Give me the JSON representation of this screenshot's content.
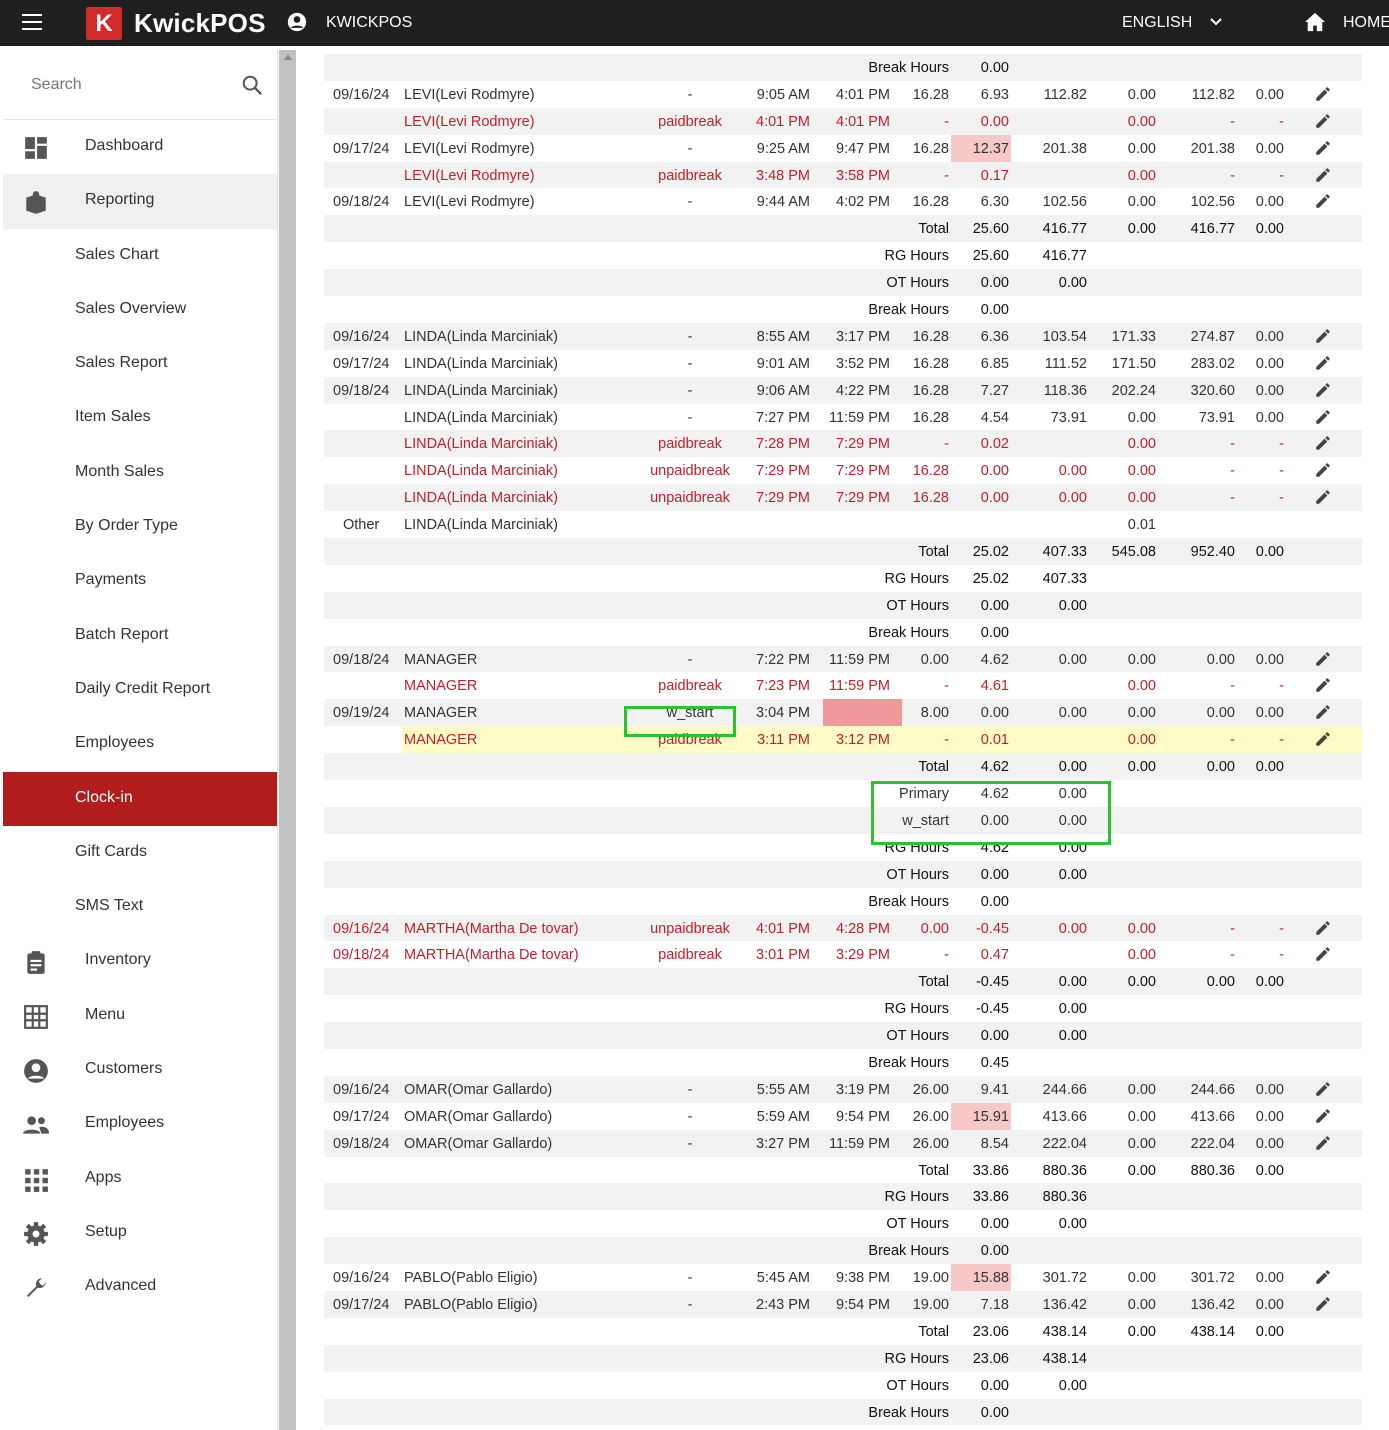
{
  "topbar": {
    "logo_letter": "K",
    "brand": "KwickPOS",
    "store_name": "KWICKPOS",
    "language": "ENGLISH",
    "home_label": "HOME"
  },
  "sidebar": {
    "search_placeholder": "Search",
    "items": [
      {
        "label": "Dashboard",
        "icon": "dashboard-icon",
        "level": "top"
      },
      {
        "label": "Reporting",
        "icon": "reporting-icon",
        "level": "top",
        "open": true
      },
      {
        "label": "Sales Chart",
        "level": "sub"
      },
      {
        "label": "Sales Overview",
        "level": "sub"
      },
      {
        "label": "Sales Report",
        "level": "sub"
      },
      {
        "label": "Item Sales",
        "level": "sub"
      },
      {
        "label": "Month Sales",
        "level": "sub"
      },
      {
        "label": "By Order Type",
        "level": "sub"
      },
      {
        "label": "Payments",
        "level": "sub"
      },
      {
        "label": "Batch Report",
        "level": "sub"
      },
      {
        "label": "Daily Credit Report",
        "level": "sub"
      },
      {
        "label": "Employees",
        "level": "sub"
      },
      {
        "label": "Clock-in",
        "level": "sub",
        "active": true
      },
      {
        "label": "Gift Cards",
        "level": "sub"
      },
      {
        "label": "SMS Text",
        "level": "sub"
      },
      {
        "label": "Inventory",
        "icon": "clipboard-icon",
        "level": "top"
      },
      {
        "label": "Menu",
        "icon": "grid-icon",
        "level": "top"
      },
      {
        "label": "Customers",
        "icon": "account-circle-icon",
        "level": "top"
      },
      {
        "label": "Employees",
        "icon": "people-icon",
        "level": "top"
      },
      {
        "label": "Apps",
        "icon": "apps-icon",
        "level": "top"
      },
      {
        "label": "Setup",
        "icon": "gear-icon",
        "level": "top"
      },
      {
        "label": "Advanced",
        "icon": "wrench-icon",
        "level": "top"
      }
    ]
  },
  "colors": {
    "accent": "#b11d1d",
    "red_text": "#c0202a",
    "highlight_pink": "#f8c8c8",
    "highlight_yellow": "#fffbc7",
    "green_box": "#2dc12d"
  },
  "rows": [
    {
      "kind": "sum",
      "label": "Break Hours",
      "hours": "0.00",
      "shade": true
    },
    {
      "kind": "entry",
      "date": "09/16/24",
      "emp": "LEVI(Levi Rodmyre)",
      "type": "-",
      "in": "9:05 AM",
      "out": "4:01 PM",
      "rate": "16.28",
      "hours": "6.93",
      "wage": "112.82",
      "tips": "0.00",
      "total": "112.82",
      "other": "0.00"
    },
    {
      "kind": "entry",
      "red": true,
      "emp": "LEVI(Levi Rodmyre)",
      "type": "paidbreak",
      "in": "4:01 PM",
      "out": "4:01 PM",
      "rate": "-",
      "hours": "0.00",
      "tips": "0.00",
      "total": "-",
      "other": "-",
      "shade": true
    },
    {
      "kind": "entry",
      "date": "09/17/24",
      "emp": "LEVI(Levi Rodmyre)",
      "type": "-",
      "in": "9:25 AM",
      "out": "9:47 PM",
      "rate": "16.28",
      "hours": "12.37",
      "hours_highlight": true,
      "wage": "201.38",
      "tips": "0.00",
      "total": "201.38",
      "other": "0.00"
    },
    {
      "kind": "entry",
      "red": true,
      "emp": "LEVI(Levi Rodmyre)",
      "type": "paidbreak",
      "in": "3:48 PM",
      "out": "3:58 PM",
      "rate": "-",
      "hours": "0.17",
      "tips": "0.00",
      "total": "-",
      "other": "-",
      "shade": true
    },
    {
      "kind": "entry",
      "date": "09/18/24",
      "emp": "LEVI(Levi Rodmyre)",
      "type": "-",
      "in": "9:44 AM",
      "out": "4:02 PM",
      "rate": "16.28",
      "hours": "6.30",
      "wage": "102.56",
      "tips": "0.00",
      "total": "102.56",
      "other": "0.00"
    },
    {
      "kind": "sum",
      "label": "Total",
      "hours": "25.60",
      "wage": "416.77",
      "tips": "0.00",
      "total": "416.77",
      "other": "0.00",
      "shade": true
    },
    {
      "kind": "sum",
      "label": "RG Hours",
      "hours": "25.60",
      "wage": "416.77"
    },
    {
      "kind": "sum",
      "label": "OT Hours",
      "hours": "0.00",
      "wage": "0.00",
      "shade": true
    },
    {
      "kind": "sum",
      "label": "Break Hours",
      "hours": "0.00"
    },
    {
      "kind": "entry",
      "date": "09/16/24",
      "emp": "LINDA(Linda Marciniak)",
      "type": "-",
      "in": "8:55 AM",
      "out": "3:17 PM",
      "rate": "16.28",
      "hours": "6.36",
      "wage": "103.54",
      "tips": "171.33",
      "total": "274.87",
      "other": "0.00",
      "shade": true
    },
    {
      "kind": "entry",
      "date": "09/17/24",
      "emp": "LINDA(Linda Marciniak)",
      "type": "-",
      "in": "9:01 AM",
      "out": "3:52 PM",
      "rate": "16.28",
      "hours": "6.85",
      "wage": "111.52",
      "tips": "171.50",
      "total": "283.02",
      "other": "0.00"
    },
    {
      "kind": "entry",
      "date": "09/18/24",
      "emp": "LINDA(Linda Marciniak)",
      "type": "-",
      "in": "9:06 AM",
      "out": "4:22 PM",
      "rate": "16.28",
      "hours": "7.27",
      "wage": "118.36",
      "tips": "202.24",
      "total": "320.60",
      "other": "0.00",
      "shade": true
    },
    {
      "kind": "entry",
      "emp": "LINDA(Linda Marciniak)",
      "type": "-",
      "in": "7:27 PM",
      "out": "11:59 PM",
      "rate": "16.28",
      "hours": "4.54",
      "wage": "73.91",
      "tips": "0.00",
      "total": "73.91",
      "other": "0.00"
    },
    {
      "kind": "entry",
      "red": true,
      "emp": "LINDA(Linda Marciniak)",
      "type": "paidbreak",
      "in": "7:28 PM",
      "out": "7:29 PM",
      "rate": "-",
      "hours": "0.02",
      "tips": "0.00",
      "total": "-",
      "other": "-",
      "shade": true
    },
    {
      "kind": "entry",
      "red": true,
      "emp": "LINDA(Linda Marciniak)",
      "type": "unpaidbreak",
      "in": "7:29 PM",
      "out": "7:29 PM",
      "rate": "16.28",
      "hours": "0.00",
      "wage": "0.00",
      "tips": "0.00",
      "total": "-",
      "other": "-"
    },
    {
      "kind": "entry",
      "red": true,
      "emp": "LINDA(Linda Marciniak)",
      "type": "unpaidbreak",
      "in": "7:29 PM",
      "out": "7:29 PM",
      "rate": "16.28",
      "hours": "0.00",
      "wage": "0.00",
      "tips": "0.00",
      "total": "-",
      "other": "-",
      "shade": true
    },
    {
      "kind": "other",
      "date": "Other",
      "emp": "LINDA(Linda Marciniak)",
      "tips": "0.01"
    },
    {
      "kind": "sum",
      "label": "Total",
      "hours": "25.02",
      "wage": "407.33",
      "tips": "545.08",
      "total": "952.40",
      "other": "0.00",
      "shade": true
    },
    {
      "kind": "sum",
      "label": "RG Hours",
      "hours": "25.02",
      "wage": "407.33"
    },
    {
      "kind": "sum",
      "label": "OT Hours",
      "hours": "0.00",
      "wage": "0.00",
      "shade": true
    },
    {
      "kind": "sum",
      "label": "Break Hours",
      "hours": "0.00"
    },
    {
      "kind": "entry",
      "date": "09/18/24",
      "emp": "MANAGER",
      "type": "-",
      "in": "7:22 PM",
      "out": "11:59 PM",
      "rate": "0.00",
      "hours": "4.62",
      "wage": "0.00",
      "tips": "0.00",
      "total": "0.00",
      "other": "0.00",
      "shade": true
    },
    {
      "kind": "entry",
      "red": true,
      "emp": "MANAGER",
      "type": "paidbreak",
      "in": "7:23 PM",
      "out": "11:59 PM",
      "rate": "-",
      "hours": "4.61",
      "tips": "0.00",
      "total": "-",
      "other": "-"
    },
    {
      "kind": "entry",
      "date": "09/19/24",
      "emp": "MANAGER",
      "type": "w_start",
      "type_boxed": true,
      "in": "3:04 PM",
      "out": "",
      "out_highlight": true,
      "rate": "8.00",
      "hours": "0.00",
      "wage": "0.00",
      "tips": "0.00",
      "total": "0.00",
      "other": "0.00",
      "shade": true
    },
    {
      "kind": "entry",
      "red": true,
      "yellow": true,
      "emp": "MANAGER",
      "type": "paidbreak",
      "in": "3:11 PM",
      "out": "3:12 PM",
      "rate": "-",
      "hours": "0.01",
      "tips": "0.00",
      "total": "-",
      "other": "-"
    },
    {
      "kind": "sum",
      "label": "Total",
      "hours": "4.62",
      "wage": "0.00",
      "tips": "0.00",
      "total": "0.00",
      "other": "0.00",
      "shade": true
    },
    {
      "kind": "sub",
      "label": "Primary",
      "hours": "4.62",
      "wage": "0.00"
    },
    {
      "kind": "sub",
      "label": "w_start",
      "hours": "0.00",
      "wage": "0.00",
      "shade": true
    },
    {
      "kind": "sum",
      "label": "RG Hours",
      "hours": "4.62",
      "wage": "0.00"
    },
    {
      "kind": "sum",
      "label": "OT Hours",
      "hours": "0.00",
      "wage": "0.00",
      "shade": true
    },
    {
      "kind": "sum",
      "label": "Break Hours",
      "hours": "0.00"
    },
    {
      "kind": "entry",
      "red": true,
      "date": "09/16/24",
      "emp": "MARTHA(Martha De tovar)",
      "type": "unpaidbreak",
      "in": "4:01 PM",
      "out": "4:28 PM",
      "rate": "0.00",
      "hours": "-0.45",
      "wage": "0.00",
      "tips": "0.00",
      "total": "-",
      "other": "-",
      "shade": true
    },
    {
      "kind": "entry",
      "red": true,
      "date": "09/18/24",
      "emp": "MARTHA(Martha De tovar)",
      "type": "paidbreak",
      "in": "3:01 PM",
      "out": "3:29 PM",
      "rate": "-",
      "hours": "0.47",
      "tips": "0.00",
      "total": "-",
      "other": "-"
    },
    {
      "kind": "sum",
      "label": "Total",
      "hours": "-0.45",
      "wage": "0.00",
      "tips": "0.00",
      "total": "0.00",
      "other": "0.00",
      "shade": true
    },
    {
      "kind": "sum",
      "label": "RG Hours",
      "hours": "-0.45",
      "wage": "0.00"
    },
    {
      "kind": "sum",
      "label": "OT Hours",
      "hours": "0.00",
      "wage": "0.00",
      "shade": true
    },
    {
      "kind": "sum",
      "label": "Break Hours",
      "hours": "0.45"
    },
    {
      "kind": "entry",
      "date": "09/16/24",
      "emp": "OMAR(Omar Gallardo)",
      "type": "-",
      "in": "5:55 AM",
      "out": "3:19 PM",
      "rate": "26.00",
      "hours": "9.41",
      "wage": "244.66",
      "tips": "0.00",
      "total": "244.66",
      "other": "0.00",
      "shade": true
    },
    {
      "kind": "entry",
      "date": "09/17/24",
      "emp": "OMAR(Omar Gallardo)",
      "type": "-",
      "in": "5:59 AM",
      "out": "9:54 PM",
      "rate": "26.00",
      "hours": "15.91",
      "hours_highlight": true,
      "wage": "413.66",
      "tips": "0.00",
      "total": "413.66",
      "other": "0.00"
    },
    {
      "kind": "entry",
      "date": "09/18/24",
      "emp": "OMAR(Omar Gallardo)",
      "type": "-",
      "in": "3:27 PM",
      "out": "11:59 PM",
      "rate": "26.00",
      "hours": "8.54",
      "wage": "222.04",
      "tips": "0.00",
      "total": "222.04",
      "other": "0.00",
      "shade": true
    },
    {
      "kind": "sum",
      "label": "Total",
      "hours": "33.86",
      "wage": "880.36",
      "tips": "0.00",
      "total": "880.36",
      "other": "0.00"
    },
    {
      "kind": "sum",
      "label": "RG Hours",
      "hours": "33.86",
      "wage": "880.36",
      "shade": true
    },
    {
      "kind": "sum",
      "label": "OT Hours",
      "hours": "0.00",
      "wage": "0.00"
    },
    {
      "kind": "sum",
      "label": "Break Hours",
      "hours": "0.00",
      "shade": true
    },
    {
      "kind": "entry",
      "date": "09/16/24",
      "emp": "PABLO(Pablo Eligio)",
      "type": "-",
      "in": "5:45 AM",
      "out": "9:38 PM",
      "rate": "19.00",
      "hours": "15.88",
      "hours_highlight": true,
      "wage": "301.72",
      "tips": "0.00",
      "total": "301.72",
      "other": "0.00"
    },
    {
      "kind": "entry",
      "date": "09/17/24",
      "emp": "PABLO(Pablo Eligio)",
      "type": "-",
      "in": "2:43 PM",
      "out": "9:54 PM",
      "rate": "19.00",
      "hours": "7.18",
      "wage": "136.42",
      "tips": "0.00",
      "total": "136.42",
      "other": "0.00",
      "shade": true
    },
    {
      "kind": "sum",
      "label": "Total",
      "hours": "23.06",
      "wage": "438.14",
      "tips": "0.00",
      "total": "438.14",
      "other": "0.00"
    },
    {
      "kind": "sum",
      "label": "RG Hours",
      "hours": "23.06",
      "wage": "438.14",
      "shade": true
    },
    {
      "kind": "sum",
      "label": "OT Hours",
      "hours": "0.00",
      "wage": "0.00"
    },
    {
      "kind": "sum",
      "label": "Break Hours",
      "hours": "0.00",
      "shade": true
    }
  ]
}
